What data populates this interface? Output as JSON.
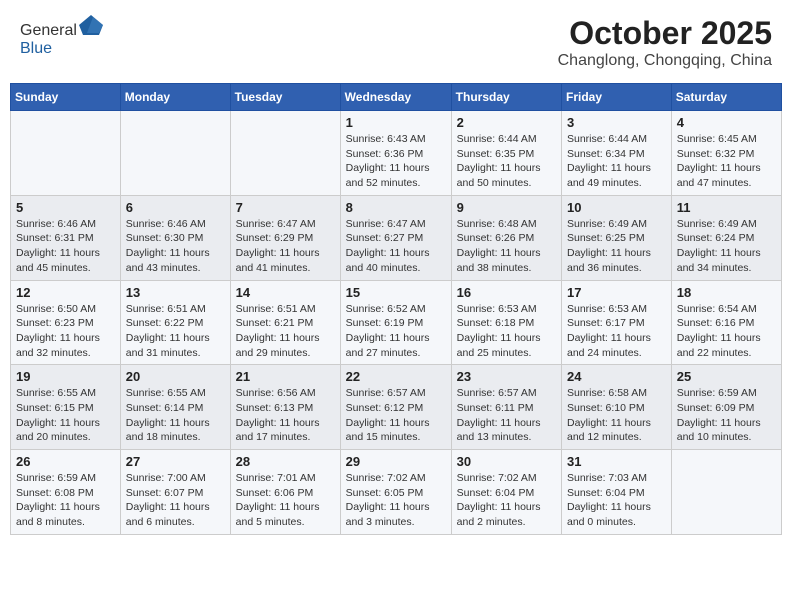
{
  "logo": {
    "general": "General",
    "blue": "Blue"
  },
  "header": {
    "month": "October 2025",
    "location": "Changlong, Chongqing, China"
  },
  "weekdays": [
    "Sunday",
    "Monday",
    "Tuesday",
    "Wednesday",
    "Thursday",
    "Friday",
    "Saturday"
  ],
  "weeks": [
    [
      {
        "day": "",
        "info": ""
      },
      {
        "day": "",
        "info": ""
      },
      {
        "day": "",
        "info": ""
      },
      {
        "day": "1",
        "info": "Sunrise: 6:43 AM\nSunset: 6:36 PM\nDaylight: 11 hours\nand 52 minutes."
      },
      {
        "day": "2",
        "info": "Sunrise: 6:44 AM\nSunset: 6:35 PM\nDaylight: 11 hours\nand 50 minutes."
      },
      {
        "day": "3",
        "info": "Sunrise: 6:44 AM\nSunset: 6:34 PM\nDaylight: 11 hours\nand 49 minutes."
      },
      {
        "day": "4",
        "info": "Sunrise: 6:45 AM\nSunset: 6:32 PM\nDaylight: 11 hours\nand 47 minutes."
      }
    ],
    [
      {
        "day": "5",
        "info": "Sunrise: 6:46 AM\nSunset: 6:31 PM\nDaylight: 11 hours\nand 45 minutes."
      },
      {
        "day": "6",
        "info": "Sunrise: 6:46 AM\nSunset: 6:30 PM\nDaylight: 11 hours\nand 43 minutes."
      },
      {
        "day": "7",
        "info": "Sunrise: 6:47 AM\nSunset: 6:29 PM\nDaylight: 11 hours\nand 41 minutes."
      },
      {
        "day": "8",
        "info": "Sunrise: 6:47 AM\nSunset: 6:27 PM\nDaylight: 11 hours\nand 40 minutes."
      },
      {
        "day": "9",
        "info": "Sunrise: 6:48 AM\nSunset: 6:26 PM\nDaylight: 11 hours\nand 38 minutes."
      },
      {
        "day": "10",
        "info": "Sunrise: 6:49 AM\nSunset: 6:25 PM\nDaylight: 11 hours\nand 36 minutes."
      },
      {
        "day": "11",
        "info": "Sunrise: 6:49 AM\nSunset: 6:24 PM\nDaylight: 11 hours\nand 34 minutes."
      }
    ],
    [
      {
        "day": "12",
        "info": "Sunrise: 6:50 AM\nSunset: 6:23 PM\nDaylight: 11 hours\nand 32 minutes."
      },
      {
        "day": "13",
        "info": "Sunrise: 6:51 AM\nSunset: 6:22 PM\nDaylight: 11 hours\nand 31 minutes."
      },
      {
        "day": "14",
        "info": "Sunrise: 6:51 AM\nSunset: 6:21 PM\nDaylight: 11 hours\nand 29 minutes."
      },
      {
        "day": "15",
        "info": "Sunrise: 6:52 AM\nSunset: 6:19 PM\nDaylight: 11 hours\nand 27 minutes."
      },
      {
        "day": "16",
        "info": "Sunrise: 6:53 AM\nSunset: 6:18 PM\nDaylight: 11 hours\nand 25 minutes."
      },
      {
        "day": "17",
        "info": "Sunrise: 6:53 AM\nSunset: 6:17 PM\nDaylight: 11 hours\nand 24 minutes."
      },
      {
        "day": "18",
        "info": "Sunrise: 6:54 AM\nSunset: 6:16 PM\nDaylight: 11 hours\nand 22 minutes."
      }
    ],
    [
      {
        "day": "19",
        "info": "Sunrise: 6:55 AM\nSunset: 6:15 PM\nDaylight: 11 hours\nand 20 minutes."
      },
      {
        "day": "20",
        "info": "Sunrise: 6:55 AM\nSunset: 6:14 PM\nDaylight: 11 hours\nand 18 minutes."
      },
      {
        "day": "21",
        "info": "Sunrise: 6:56 AM\nSunset: 6:13 PM\nDaylight: 11 hours\nand 17 minutes."
      },
      {
        "day": "22",
        "info": "Sunrise: 6:57 AM\nSunset: 6:12 PM\nDaylight: 11 hours\nand 15 minutes."
      },
      {
        "day": "23",
        "info": "Sunrise: 6:57 AM\nSunset: 6:11 PM\nDaylight: 11 hours\nand 13 minutes."
      },
      {
        "day": "24",
        "info": "Sunrise: 6:58 AM\nSunset: 6:10 PM\nDaylight: 11 hours\nand 12 minutes."
      },
      {
        "day": "25",
        "info": "Sunrise: 6:59 AM\nSunset: 6:09 PM\nDaylight: 11 hours\nand 10 minutes."
      }
    ],
    [
      {
        "day": "26",
        "info": "Sunrise: 6:59 AM\nSunset: 6:08 PM\nDaylight: 11 hours\nand 8 minutes."
      },
      {
        "day": "27",
        "info": "Sunrise: 7:00 AM\nSunset: 6:07 PM\nDaylight: 11 hours\nand 6 minutes."
      },
      {
        "day": "28",
        "info": "Sunrise: 7:01 AM\nSunset: 6:06 PM\nDaylight: 11 hours\nand 5 minutes."
      },
      {
        "day": "29",
        "info": "Sunrise: 7:02 AM\nSunset: 6:05 PM\nDaylight: 11 hours\nand 3 minutes."
      },
      {
        "day": "30",
        "info": "Sunrise: 7:02 AM\nSunset: 6:04 PM\nDaylight: 11 hours\nand 2 minutes."
      },
      {
        "day": "31",
        "info": "Sunrise: 7:03 AM\nSunset: 6:04 PM\nDaylight: 11 hours\nand 0 minutes."
      },
      {
        "day": "",
        "info": ""
      }
    ]
  ]
}
